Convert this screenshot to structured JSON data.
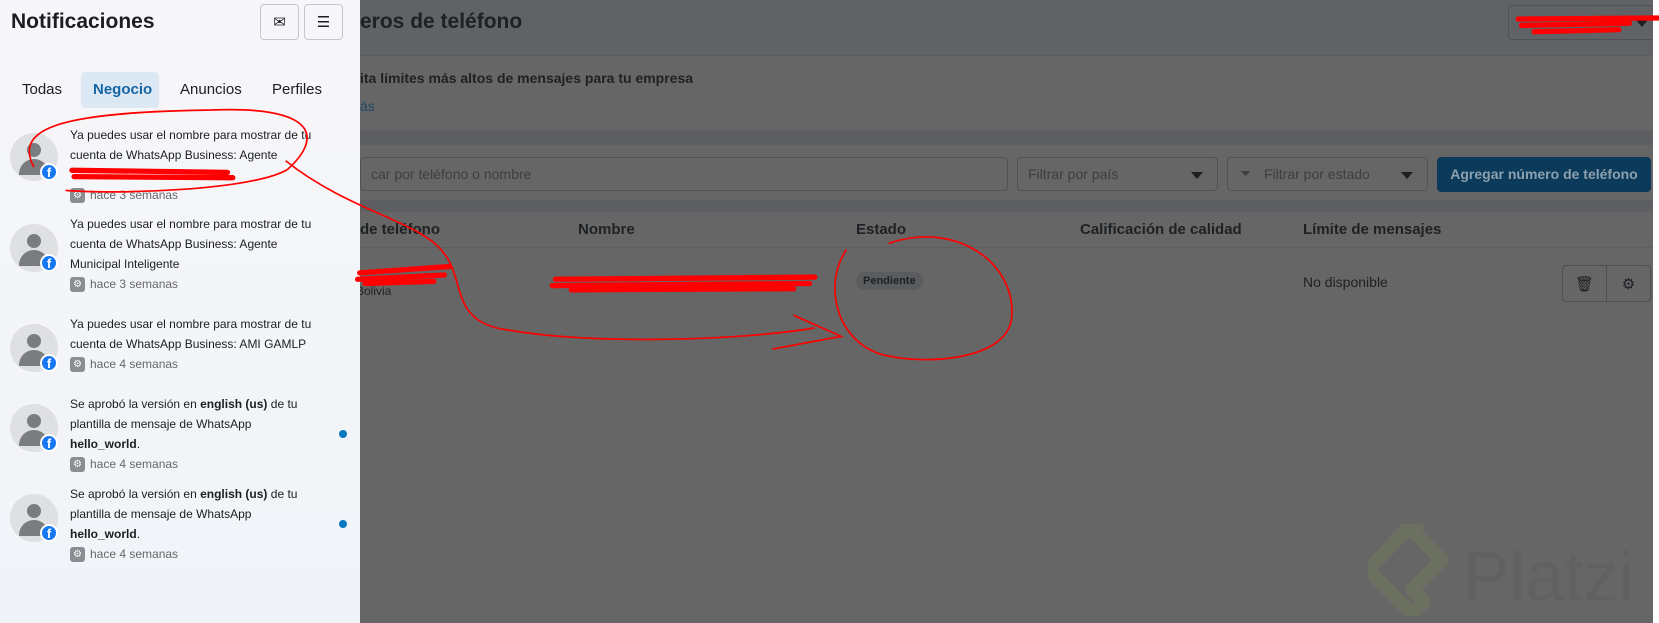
{
  "header": {
    "title": "eros de teléfono"
  },
  "banner": {
    "text": "ita límites más altos de mensajes para tu empresa",
    "link": "ás"
  },
  "filters": {
    "search_placeholder": "car por teléfono o nombre",
    "country": "Filtrar por país",
    "status": "Filtrar por estado",
    "add_button": "Agregar número de teléfono"
  },
  "table": {
    "columns": [
      "de teléfono",
      "Nombre",
      "Estado",
      "Calificación de calidad",
      "Límite de mensajes"
    ],
    "rows": [
      {
        "country": "Bolivia",
        "status": "Pendiente",
        "limit": "No disponible"
      }
    ]
  },
  "panel": {
    "title": "Notificaciones",
    "tabs": [
      "Todas",
      "Negocio",
      "Anuncios",
      "Perfiles"
    ],
    "items": [
      {
        "text": "Ya puedes usar el nombre para mostrar de tu cuenta de WhatsApp Business: Agente",
        "time": "hace 3 semanas",
        "unread": false
      },
      {
        "text": "Ya puedes usar el nombre para mostrar de tu cuenta de WhatsApp Business: Agente Municipal Inteligente",
        "time": "hace 3 semanas",
        "unread": false
      },
      {
        "text": "Ya puedes usar el nombre para mostrar de tu cuenta de WhatsApp Business: AMI GAMLP",
        "time": "hace 4 semanas",
        "unread": false
      },
      {
        "pre": "Se aprobó la versión en ",
        "bold1": "english (us)",
        "mid": " de tu plantilla de mensaje de WhatsApp ",
        "bold2": "hello_world",
        "post": ".",
        "time": "hace 4 semanas",
        "unread": true
      },
      {
        "pre": "Se aprobó la versión en ",
        "bold1": "english (us)",
        "mid": " de tu plantilla de mensaje de WhatsApp ",
        "bold2": "hello_world",
        "post": ".",
        "time": "hace 4 semanas",
        "unread": true
      }
    ]
  },
  "watermark": "Platzi",
  "colors": {
    "accent": "#1565a5",
    "annotation": "#ff0000",
    "unread_dot": "#0a78be"
  }
}
